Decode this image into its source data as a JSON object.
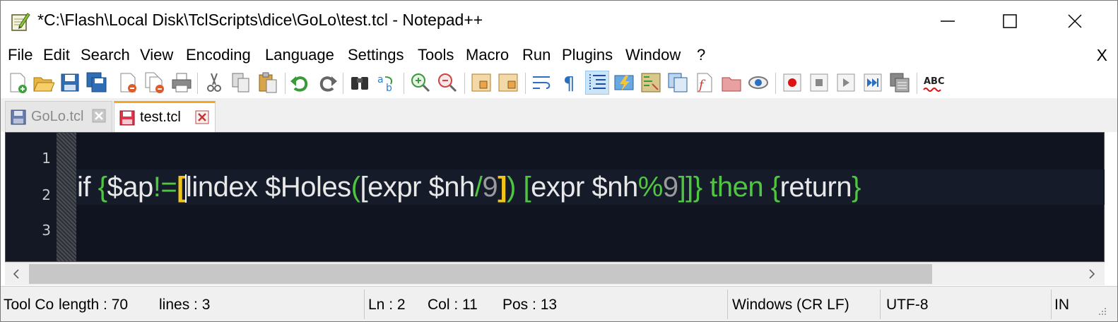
{
  "window": {
    "title": "*C:\\Flash\\Local Disk\\TclScripts\\dice\\GoLo\\test.tcl - Notepad++",
    "icons": {
      "app": "notepad-plus-icon",
      "minimize": "minimize-icon",
      "maximize": "maximize-icon",
      "close": "close-icon"
    }
  },
  "menu": {
    "items": [
      {
        "label": "File"
      },
      {
        "label": "Edit"
      },
      {
        "label": "Search"
      },
      {
        "label": "View"
      },
      {
        "label": "Encoding"
      },
      {
        "label": "Language"
      },
      {
        "label": "Settings"
      },
      {
        "label": "Tools"
      },
      {
        "label": "Macro"
      },
      {
        "label": "Run"
      },
      {
        "label": "Plugins"
      },
      {
        "label": "Window"
      },
      {
        "label": "?"
      }
    ],
    "close_label": "X"
  },
  "toolbar": {
    "icons": [
      "new-file-icon",
      "open-file-icon",
      "save-icon",
      "save-all-icon",
      "close-icon",
      "close-all-icon",
      "print-icon",
      "cut-icon",
      "copy-icon",
      "paste-icon",
      "undo-icon",
      "redo-icon",
      "find-icon",
      "replace-icon",
      "zoom-in-icon",
      "zoom-out-icon",
      "sync-vertical-icon",
      "sync-horizontal-icon",
      "word-wrap-icon",
      "show-all-chars-icon",
      "indent-guide-icon",
      "user-lang-icon",
      "doc-map-icon",
      "function-list-icon",
      "folder-workspace-icon",
      "folder-icon",
      "monitoring-icon",
      "record-macro-icon",
      "stop-macro-icon",
      "play-macro-icon",
      "run-macro-multiple-icon",
      "save-macro-icon",
      "spell-check-icon"
    ]
  },
  "tabs": [
    {
      "label": "GoLo.tcl",
      "active": false
    },
    {
      "label": "test.tcl",
      "active": true
    }
  ],
  "editor": {
    "line_numbers": [
      "1",
      "2",
      "3"
    ],
    "code": {
      "t1": "if ",
      "t2": "{",
      "t3": "$ap",
      "t4": "!=",
      "t5": "[",
      "t6": "lindex $Holes",
      "t7": "(",
      "t8": "[expr $nh",
      "t9": "/",
      "t10": "9",
      "t11": "]",
      "t12": ")",
      "t13": " [",
      "t14": "expr $nh",
      "t15": "%",
      "t16": "9",
      "t17": "]]",
      "t18": "}",
      "t19": " then ",
      "t20": "{",
      "t21": "return",
      "t22": "}"
    },
    "colors": {
      "background": "#0f1420",
      "keyword": "#e8e8e8",
      "operator": "#4ec641",
      "number": "#9a9a9a",
      "brace_match": "#f2c418"
    }
  },
  "statusbar": {
    "tooltip": "Tool Co",
    "length": "length : 70",
    "lines": "lines : 3",
    "ln": "Ln : 2",
    "col": "Col : 11",
    "pos": "Pos : 13",
    "eol": "Windows (CR LF)",
    "encoding": "UTF-8",
    "mode": "IN"
  }
}
